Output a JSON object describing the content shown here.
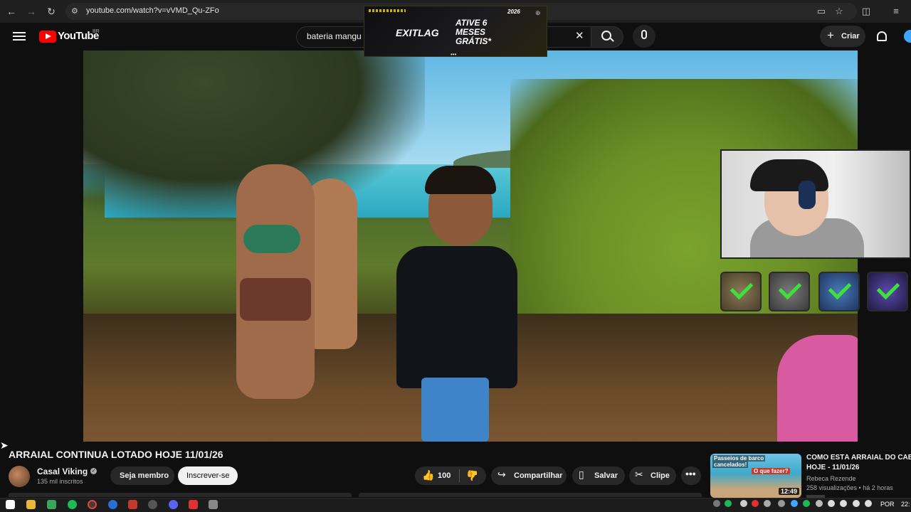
{
  "browser": {
    "url": "youtube.com/watch?v=vVMD_Qu-ZFo",
    "icons": [
      "back-icon",
      "forward-icon",
      "reload-icon",
      "site-info-icon",
      "screen-cast-icon",
      "bookmark-star-icon",
      "extensions-icon",
      "menu-icon"
    ]
  },
  "header": {
    "logo_text": "YouTube",
    "region": "BR",
    "search_value": "bateria mangu",
    "create_label": "Criar"
  },
  "ad": {
    "brand": "EXITLAG",
    "cta": "ATIVE 6 MESES GRÁTIS*",
    "year": "2026",
    "dots": "•••"
  },
  "video": {
    "title": "ARRAIAL CONTINUA LOTADO HOJE 11/01/26"
  },
  "channel": {
    "name": "Casal Viking",
    "subscribers": "135 mil inscritos",
    "member_label": "Seja membro",
    "subscribe_label": "Inscrever-se"
  },
  "actions": {
    "like_count": "100",
    "share_label": "Compartilhar",
    "save_label": "Salvar",
    "clip_label": "Clipe"
  },
  "recommended": {
    "thumb_line1": "Passeios de barco",
    "thumb_line2": "cancelados!",
    "thumb_line3": "O que fazer?",
    "duration": "12:49",
    "title_line1": "COMO ESTÁ ARRAIAL DO CABO",
    "title_line2": "HOJE - 11/01/26",
    "channel": "Rebeca Rezende",
    "meta": "258 visualizações • há 2 horas"
  },
  "taskbar": {
    "language": "POR",
    "time": "22:"
  },
  "colors": {
    "brand_red": "#ff0000",
    "check_green": "#3ee03e",
    "background": "#0f0f0f"
  }
}
